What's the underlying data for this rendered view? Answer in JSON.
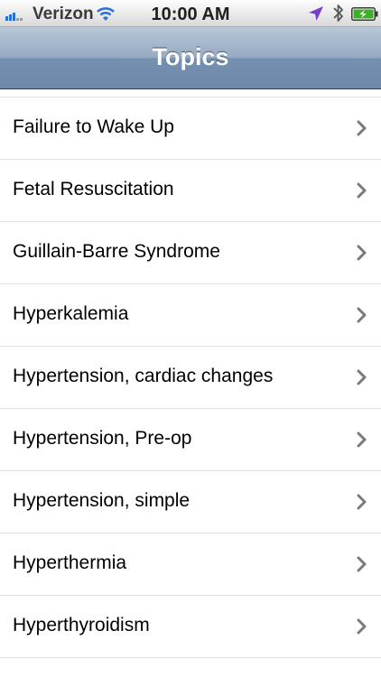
{
  "status_bar": {
    "carrier": "Verizon",
    "time": "10:00 AM",
    "icons": [
      "signal-icon",
      "wifi-icon",
      "location-arrow-icon",
      "bluetooth-icon",
      "battery-charging-icon"
    ],
    "location_color": "#7a3cc9",
    "battery_color": "#3fae2a"
  },
  "nav_bar": {
    "title": "Topics"
  },
  "topics": [
    {
      "label": "Failure to Wake Up"
    },
    {
      "label": "Fetal Resuscitation"
    },
    {
      "label": "Guillain-Barre Syndrome"
    },
    {
      "label": "Hyperkalemia"
    },
    {
      "label": "Hypertension, cardiac changes"
    },
    {
      "label": "Hypertension, Pre-op"
    },
    {
      "label": "Hypertension, simple"
    },
    {
      "label": "Hyperthermia"
    },
    {
      "label": "Hyperthyroidism"
    }
  ],
  "row_accessory_icon": "chevron-right-icon"
}
